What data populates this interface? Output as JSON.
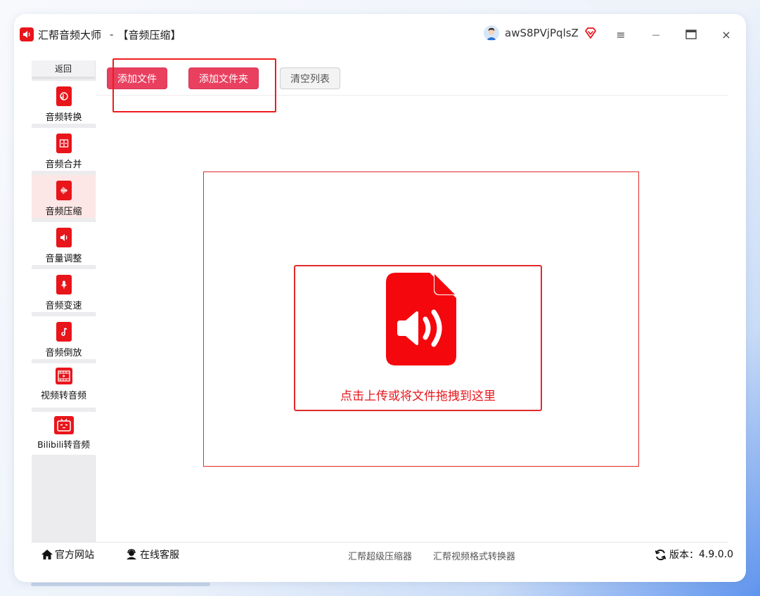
{
  "window": {
    "app_name": "汇帮音频大师",
    "separator": "-",
    "module_title": "【音频压缩】"
  },
  "user": {
    "name": "awS8PVjPqlsZ"
  },
  "window_controls": {
    "menu": "≡",
    "minimize": "—",
    "maximize": "▭",
    "close": "×"
  },
  "sidebar": {
    "back_label": "返回",
    "items": [
      {
        "label": "音频转换",
        "icon": "audio-convert-icon"
      },
      {
        "label": "音频合并",
        "icon": "audio-merge-icon"
      },
      {
        "label": "音频压缩",
        "icon": "audio-compress-icon",
        "active": true
      },
      {
        "label": "音量调整",
        "icon": "volume-adjust-icon"
      },
      {
        "label": "音频变速",
        "icon": "audio-speed-icon"
      },
      {
        "label": "音频倒放",
        "icon": "audio-reverse-icon"
      },
      {
        "label": "视频转音频",
        "icon": "video-to-audio-icon"
      },
      {
        "label": "Bilibili转音频",
        "icon": "bilibili-icon"
      }
    ]
  },
  "toolbar": {
    "add_file": "添加文件",
    "add_folder": "添加文件夹",
    "clear_list": "清空列表"
  },
  "dropzone": {
    "text": "点击上传或将文件拖拽到这里"
  },
  "footer": {
    "official_site": "官方网站",
    "online_service": "在线客服",
    "link1": "汇帮超级压缩器",
    "link2": "汇帮视频格式转换器",
    "version_label": "版本：",
    "version_value": "4.9.0.0"
  },
  "colors": {
    "brand_red": "#e8151b",
    "button_pink": "#e94060",
    "active_bg": "#fce7e6"
  }
}
